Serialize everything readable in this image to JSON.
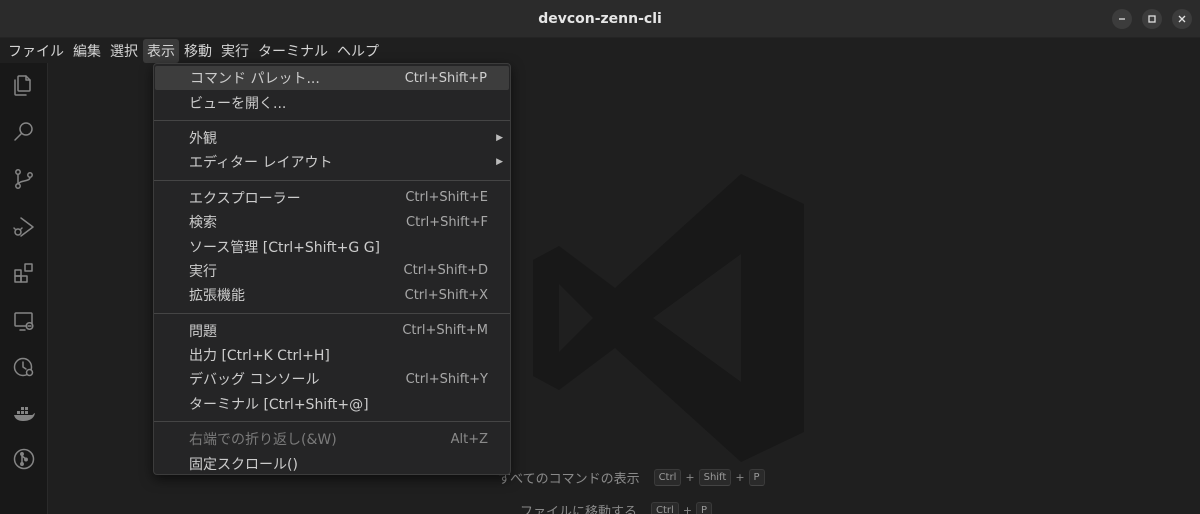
{
  "window": {
    "title": "devcon-zenn-cli"
  },
  "menubar": {
    "items": [
      {
        "label": "ファイル"
      },
      {
        "label": "編集"
      },
      {
        "label": "選択"
      },
      {
        "label": "表示",
        "active": true
      },
      {
        "label": "移動"
      },
      {
        "label": "実行"
      },
      {
        "label": "ターミナル"
      },
      {
        "label": "ヘルプ"
      }
    ]
  },
  "activity_bar": {
    "icons": [
      "explorer-icon",
      "search-icon",
      "source-control-icon",
      "run-debug-icon",
      "extensions-icon",
      "remote-explorer-icon",
      "timeline-icon",
      "docker-icon",
      "git-graph-icon"
    ]
  },
  "view_menu": {
    "groups": [
      [
        {
          "label": "コマンド パレット...",
          "shortcut": "Ctrl+Shift+P",
          "highlighted": true
        },
        {
          "label": "ビューを開く...",
          "shortcut": ""
        }
      ],
      [
        {
          "label": "外観",
          "shortcut": "",
          "submenu": true
        },
        {
          "label": "エディター レイアウト",
          "shortcut": "",
          "submenu": true
        }
      ],
      [
        {
          "label": "エクスプローラー",
          "shortcut": "Ctrl+Shift+E"
        },
        {
          "label": "検索",
          "shortcut": "Ctrl+Shift+F"
        },
        {
          "label": "ソース管理 [Ctrl+Shift+G G]",
          "shortcut": ""
        },
        {
          "label": "実行",
          "shortcut": "Ctrl+Shift+D"
        },
        {
          "label": "拡張機能",
          "shortcut": "Ctrl+Shift+X"
        }
      ],
      [
        {
          "label": "問題",
          "shortcut": "Ctrl+Shift+M"
        },
        {
          "label": "出力 [Ctrl+K Ctrl+H]",
          "shortcut": ""
        },
        {
          "label": "デバッグ コンソール",
          "shortcut": "Ctrl+Shift+Y"
        },
        {
          "label": "ターミナル [Ctrl+Shift+@]",
          "shortcut": ""
        }
      ],
      [
        {
          "label": "右端での折り返し(&W)",
          "shortcut": "Alt+Z",
          "disabled": true
        },
        {
          "label": "固定スクロール()",
          "shortcut": ""
        }
      ]
    ]
  },
  "editor_hints": [
    {
      "label": "すべてのコマンドの表示",
      "keys": [
        "Ctrl",
        "Shift",
        "P"
      ]
    },
    {
      "label": "ファイルに移動する",
      "keys": [
        "Ctrl",
        "P"
      ]
    }
  ],
  "colors": {
    "background": "#1f1f1f",
    "menu_background": "#252526",
    "highlight": "#3d3d3d"
  }
}
